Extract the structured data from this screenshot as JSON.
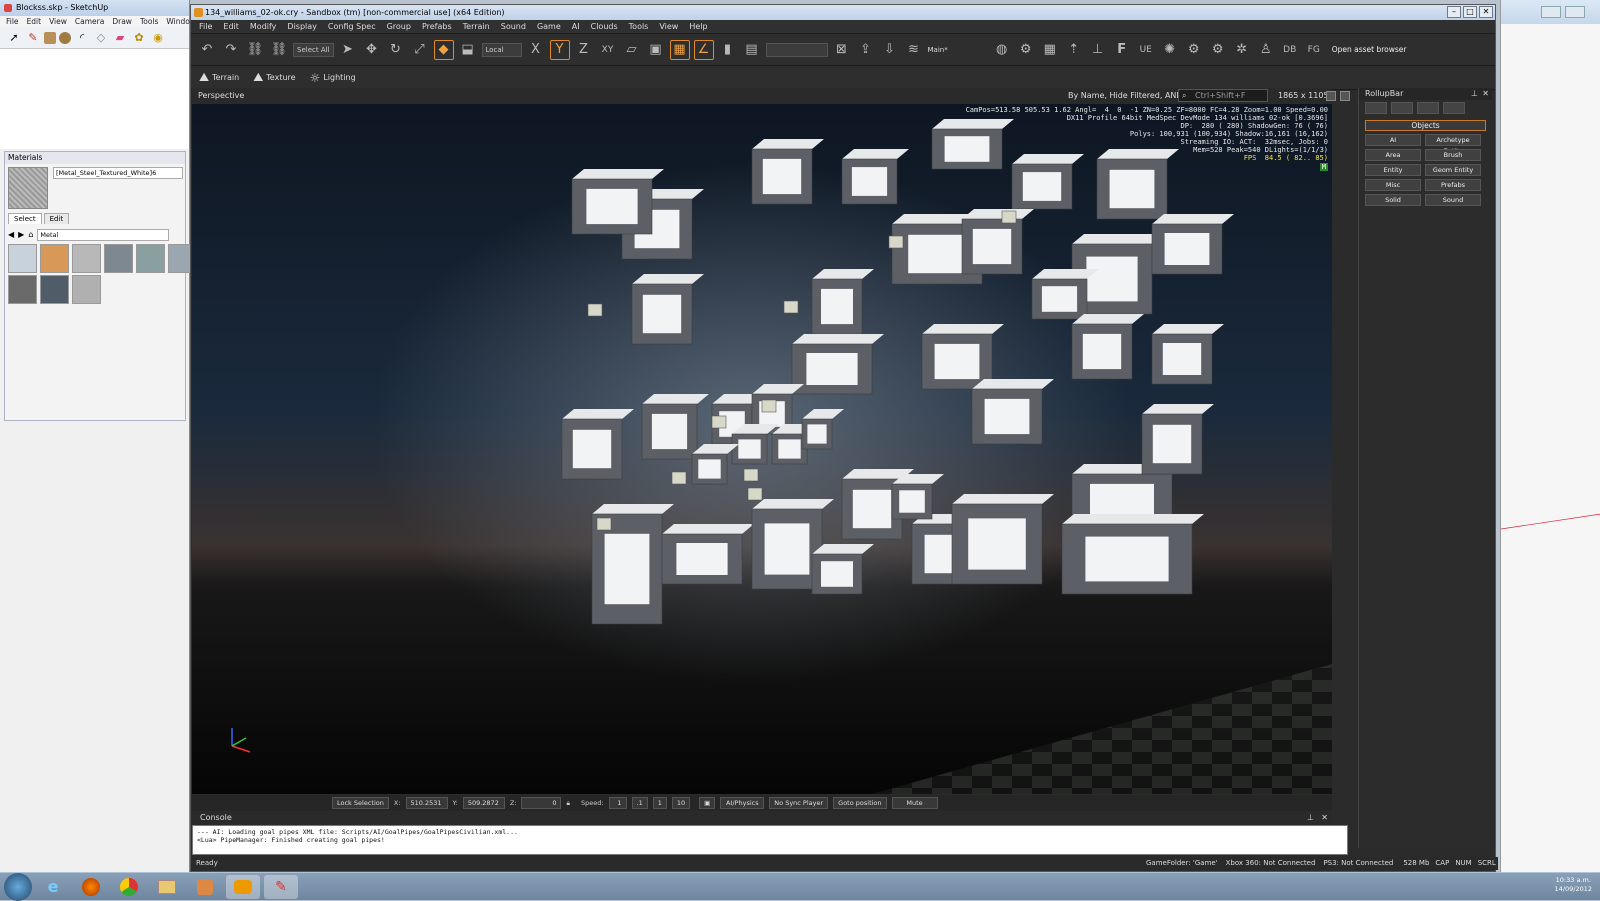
{
  "sketchup": {
    "title": "Blockss.skp - SketchUp",
    "menu": [
      "File",
      "Edit",
      "View",
      "Camera",
      "Draw",
      "Tools",
      "Window"
    ],
    "materials": {
      "panel_title": "Materials",
      "material_name": "[Metal_Steel_Textured_White]6",
      "tabs": [
        "Select",
        "Edit"
      ],
      "search_value": "Metal",
      "swatch_colors": [
        "#c8d2dc",
        "#d89858",
        "#b8b8b8",
        "#7e8890",
        "#8aa0a0",
        "#9aa6b0",
        "#6a6a6a",
        "#505c68",
        "#b0b0b0"
      ]
    }
  },
  "sandbox": {
    "title": "134_williams_02-ok.cry - Sandbox (tm) [non-commercial use] (x64 Edition)",
    "menu": [
      "File",
      "Edit",
      "Modify",
      "Display",
      "Config Spec",
      "Group",
      "Prefabs",
      "Terrain",
      "Sound",
      "Game",
      "AI",
      "Clouds",
      "Tools",
      "View",
      "Help"
    ],
    "toolbar": {
      "select_all": "Select All",
      "coord_system": "Local",
      "axis_x": "X",
      "axis_y": "Y",
      "axis_z": "Z",
      "axis_xy": "XY",
      "layer": "Main*",
      "open_asset_browser": "Open asset browser"
    },
    "toolbar2": {
      "terrain": "Terrain",
      "texture": "Texture",
      "lighting": "Lighting"
    },
    "viewport": {
      "label": "Perspective",
      "filter_text": "By Name, Hide Filtered, AND",
      "search_placeholder": "Ctrl+Shift+F",
      "resolution": "1865 x 1105",
      "stats": [
        "CamPos=513.58 505.53 1.62 Angl=  4  0  -1 ZN=0.25 ZF=8000 FC=4.28 Zoom=1.00 Speed=0.00",
        "DX11 Profile 64bit MedSpec DevMode 134 williams 02-ok [0.3696]",
        "DP:  280 ( 280) ShadowGen: 76 ( 76)",
        "Polys: 100,931 (100,934) Shadow:16,161 (16,162)",
        "Streaming IO: ACT:  32msec, Jobs: 0",
        "Mem=528 Peak=540 DLights=(1/1/3)"
      ],
      "fps": "FPS  84.5 ( 82.. 85)",
      "mode_badge": "M"
    },
    "rollup": {
      "title": "RollupBar",
      "category": "Objects",
      "buttons": [
        "AI",
        "Archetype Entity",
        "Area",
        "Brush",
        "Entity",
        "Geom Entity",
        "Misc",
        "Prefabs",
        "Solid",
        "Sound"
      ]
    },
    "viewport_status": {
      "lock_selection": "Lock Selection",
      "x_label": "X:",
      "x_value": "510.2531",
      "y_label": "Y:",
      "y_value": "509.2872",
      "z_label": "Z:",
      "z_value": "0",
      "speed_label": "Speed:",
      "speed_value": "1",
      "speed_presets": [
        ".1",
        "1",
        "10"
      ],
      "ai_physics": "AI/Physics",
      "no_sync_player": "No Sync Player",
      "goto_position": "Goto position",
      "mute": "Mute"
    },
    "console": {
      "title": "Console",
      "lines": [
        "--- AI: Loading goal pipes XML file: Scripts/AI/GoalPipes/GoalPipesCivilian.xml...",
        "<Lua> PipeManager: Finished creating goal pipes!"
      ]
    },
    "statusbar": {
      "ready": "Ready",
      "game_folder": "GameFolder: 'Game'",
      "xbox": "Xbox 360: Not Connected",
      "ps3": "PS3: Not Connected",
      "memory": "528 Mb",
      "cap": "CAP",
      "num": "NUM",
      "scrl": "SCRL"
    }
  },
  "taskbar": {
    "time": "10:33 a.m.",
    "date": "14/09/2012"
  }
}
